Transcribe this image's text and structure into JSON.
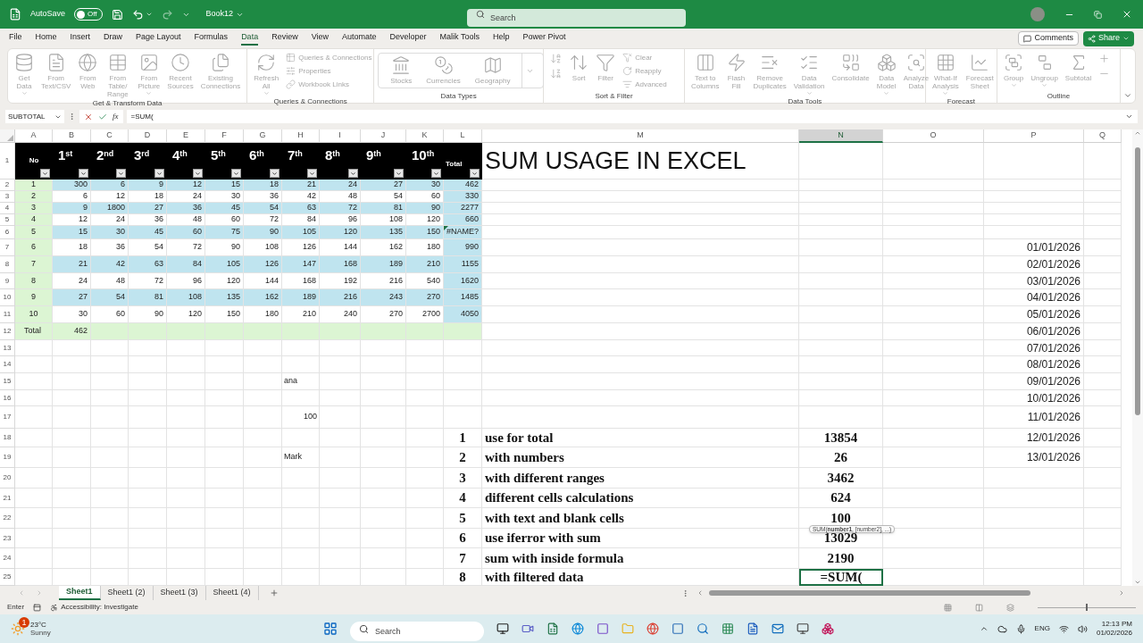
{
  "title_bar": {
    "autosave_label": "AutoSave",
    "autosave": {
      "on": false,
      "label": "Off"
    },
    "workbook": "Book12",
    "search": {
      "placeholder": "Search"
    }
  },
  "menu": {
    "tabs": [
      {
        "label": "File",
        "selected": false
      },
      {
        "label": "Home",
        "selected": false
      },
      {
        "label": "Insert",
        "selected": false
      },
      {
        "label": "Draw",
        "selected": false
      },
      {
        "label": "Page Layout",
        "selected": false
      },
      {
        "label": "Formulas",
        "selected": false
      },
      {
        "label": "Data",
        "selected": true
      },
      {
        "label": "Review",
        "selected": false
      },
      {
        "label": "View",
        "selected": false
      },
      {
        "label": "Automate",
        "selected": false
      },
      {
        "label": "Developer",
        "selected": false
      },
      {
        "label": "Malik Tools",
        "selected": false
      },
      {
        "label": "Help",
        "selected": false
      },
      {
        "label": "Power Pivot",
        "selected": false
      }
    ],
    "comments": "Comments",
    "share": "Share"
  },
  "ribbon": {
    "disabled": true,
    "groups": [
      {
        "label": "Get & Transform Data",
        "items": [
          {
            "kind": "large",
            "label": "Get\nData",
            "dropdown": true
          },
          {
            "kind": "large",
            "label": "From\nText/CSV",
            "dropdown": false
          },
          {
            "kind": "large",
            "label": "From\nWeb",
            "dropdown": false
          },
          {
            "kind": "large",
            "label": "From Table/\nRange",
            "dropdown": false
          },
          {
            "kind": "large",
            "label": "From\nPicture",
            "dropdown": true
          },
          {
            "kind": "large",
            "label": "Recent\nSources",
            "dropdown": false
          },
          {
            "kind": "large",
            "label": "Existing\nConnections",
            "dropdown": false
          }
        ]
      },
      {
        "label": "Queries & Connections",
        "items": [
          {
            "kind": "large",
            "label": "Refresh\nAll",
            "dropdown": true
          },
          {
            "kind": "small",
            "label": "Queries & Connections",
            "dropdown": false
          },
          {
            "kind": "small",
            "label": "Properties",
            "dropdown": false
          },
          {
            "kind": "small",
            "label": "Workbook Links",
            "dropdown": false
          }
        ]
      },
      {
        "label": "Data Types",
        "items": [
          {
            "kind": "gallery",
            "label": "Stocks",
            "dropdown": false
          },
          {
            "kind": "gallery",
            "label": "Currencies",
            "dropdown": false
          },
          {
            "kind": "gallery",
            "label": "Geography",
            "dropdown": false
          }
        ]
      },
      {
        "label": "Sort & Filter",
        "items": [
          {
            "kind": "icon",
            "dropdown": false
          },
          {
            "kind": "icon",
            "dropdown": false
          },
          {
            "kind": "large",
            "label": "Sort",
            "dropdown": false
          },
          {
            "kind": "large",
            "label": "Filter",
            "dropdown": false
          },
          {
            "kind": "small",
            "label": "Clear",
            "dropdown": false
          },
          {
            "kind": "small",
            "label": "Reapply",
            "dropdown": false
          },
          {
            "kind": "small",
            "label": "Advanced",
            "dropdown": false
          }
        ]
      },
      {
        "label": "Data Tools",
        "items": [
          {
            "kind": "large",
            "label": "Text to\nColumns",
            "dropdown": false
          },
          {
            "kind": "large",
            "label": "Flash\nFill",
            "dropdown": false
          },
          {
            "kind": "large",
            "label": "Remove\nDuplicates",
            "dropdown": false
          },
          {
            "kind": "large",
            "label": "Data\nValidation",
            "dropdown": true
          },
          {
            "kind": "large",
            "label": "Consolidate",
            "dropdown": false
          },
          {
            "kind": "large",
            "label": "Data\nModel",
            "dropdown": true
          },
          {
            "kind": "large",
            "label": "Analyze\nData",
            "dropdown": false
          }
        ]
      },
      {
        "label": "Forecast",
        "items": [
          {
            "kind": "large",
            "label": "What-If\nAnalysis",
            "dropdown": true
          },
          {
            "kind": "large",
            "label": "Forecast\nSheet",
            "dropdown": false
          }
        ]
      },
      {
        "label": "Outline",
        "items": [
          {
            "kind": "large",
            "label": "Group",
            "dropdown": true
          },
          {
            "kind": "large",
            "label": "Ungroup",
            "dropdown": true
          },
          {
            "kind": "large",
            "label": "Subtotal",
            "dropdown": false
          },
          {
            "kind": "icon",
            "dropdown": false
          },
          {
            "kind": "icon",
            "dropdown": false
          }
        ]
      }
    ]
  },
  "formula_bar": {
    "name_box": "SUBTOTAL",
    "function_label": "fx",
    "formula": "=SUM("
  },
  "sheet": {
    "columns": [
      {
        "label": "A",
        "selected": false
      },
      {
        "label": "B",
        "selected": false
      },
      {
        "label": "C",
        "selected": false
      },
      {
        "label": "D",
        "selected": false
      },
      {
        "label": "E",
        "selected": false
      },
      {
        "label": "F",
        "selected": false
      },
      {
        "label": "G",
        "selected": false
      },
      {
        "label": "H",
        "selected": false
      },
      {
        "label": "I",
        "selected": false
      },
      {
        "label": "J",
        "selected": false
      },
      {
        "label": "K",
        "selected": false
      },
      {
        "label": "L",
        "selected": false
      },
      {
        "label": "M",
        "selected": false
      },
      {
        "label": "N",
        "selected": true
      },
      {
        "label": "O",
        "selected": false
      },
      {
        "label": "P",
        "selected": false
      },
      {
        "label": "Q",
        "selected": false
      }
    ],
    "row_numbers": [
      "1",
      "2",
      "3",
      "4",
      "5",
      "6",
      "7",
      "8",
      "9",
      "10",
      "11",
      "12",
      "13",
      "14",
      "15",
      "16",
      "17",
      "18",
      "19",
      "20",
      "21",
      "22",
      "23",
      "24",
      "25"
    ],
    "data_table": {
      "headers": [
        {
          "kind": "label",
          "text": "No"
        },
        {
          "kind": "ordinal",
          "text": "1$^{st}$"
        },
        {
          "kind": "ordinal",
          "text": "2$^{nd}$"
        },
        {
          "kind": "ordinal",
          "text": "3$^{rd}$"
        },
        {
          "kind": "ordinal",
          "text": "4$^{th}$"
        },
        {
          "kind": "ordinal",
          "text": "5$^{th}$"
        },
        {
          "kind": "ordinal",
          "text": "6$^{th}$"
        },
        {
          "kind": "ordinal",
          "text": "7$^{th}$"
        },
        {
          "kind": "ordinal",
          "text": "8$^{th}$"
        },
        {
          "kind": "ordinal",
          "text": "9$^{th}$"
        },
        {
          "kind": "ordinal",
          "text": "10$^{th}$"
        },
        {
          "kind": "label",
          "text": "Total"
        }
      ],
      "rows": [
        {
          "values": [
            "1",
            "300",
            "6",
            "9",
            "12",
            "15",
            "18",
            "21",
            "24",
            "27",
            "30"
          ],
          "total": "462",
          "flagged": false
        },
        {
          "values": [
            "2",
            "6",
            "12",
            "18",
            "24",
            "30",
            "36",
            "42",
            "48",
            "54",
            "60"
          ],
          "total": "330",
          "flagged": false
        },
        {
          "values": [
            "3",
            "9",
            "1800",
            "27",
            "36",
            "45",
            "54",
            "63",
            "72",
            "81",
            "90"
          ],
          "total": "2277",
          "flagged": false
        },
        {
          "values": [
            "4",
            "12",
            "24",
            "36",
            "48",
            "60",
            "72",
            "84",
            "96",
            "108",
            "120"
          ],
          "total": "660",
          "flagged": false
        },
        {
          "values": [
            "5",
            "15",
            "30",
            "45",
            "60",
            "75",
            "90",
            "105",
            "120",
            "135",
            "150"
          ],
          "total": "#NAME?",
          "flagged": true
        },
        {
          "values": [
            "6",
            "18",
            "36",
            "54",
            "72",
            "90",
            "108",
            "126",
            "144",
            "162",
            "180"
          ],
          "total": "990",
          "flagged": false
        },
        {
          "values": [
            "7",
            "21",
            "42",
            "63",
            "84",
            "105",
            "126",
            "147",
            "168",
            "189",
            "210"
          ],
          "total": "1155",
          "flagged": false
        },
        {
          "values": [
            "8",
            "24",
            "48",
            "72",
            "96",
            "120",
            "144",
            "168",
            "192",
            "216",
            "540"
          ],
          "total": "1620",
          "flagged": false
        },
        {
          "values": [
            "9",
            "27",
            "54",
            "81",
            "108",
            "135",
            "162",
            "189",
            "216",
            "243",
            "270"
          ],
          "total": "1485",
          "flagged": false
        },
        {
          "values": [
            "10",
            "30",
            "60",
            "90",
            "120",
            "150",
            "180",
            "210",
            "240",
            "270",
            "2700"
          ],
          "total": "4050",
          "flagged": false
        }
      ],
      "total_row": [
        "Total",
        "462"
      ]
    },
    "title": "SUM USAGE IN EXCEL",
    "notes": [
      {
        "kind": "text",
        "text": "ana"
      },
      {
        "kind": "number",
        "text": "100"
      },
      {
        "kind": "text",
        "text": "Mark"
      }
    ],
    "dates": [
      "01/01/2026",
      "02/01/2026",
      "03/01/2026",
      "04/01/2026",
      "05/01/2026",
      "06/01/2026",
      "07/01/2026",
      "08/01/2026",
      "09/01/2026",
      "10/01/2026",
      "11/01/2026",
      "12/01/2026",
      "13/01/2026"
    ],
    "sum_usage": [
      {
        "number": "1",
        "label": "use for total",
        "result": "13854",
        "active": false
      },
      {
        "number": "2",
        "label": "with numbers",
        "result": "26",
        "active": false
      },
      {
        "number": "3",
        "label": "with different ranges",
        "result": "3462",
        "active": false
      },
      {
        "number": "4",
        "label": "different cells calculations",
        "result": "624",
        "active": false
      },
      {
        "number": "5",
        "label": "with text and blank cells",
        "result": "100",
        "active": false
      },
      {
        "number": "6",
        "label": "use iferror with sum",
        "result": "13029",
        "active": false
      },
      {
        "number": "7",
        "label": "sum with inside formula",
        "result": "2190",
        "active": false
      },
      {
        "number": "8",
        "label": "with filtered data",
        "result": "=SUM(",
        "active": true
      }
    ],
    "tooltip": "SUM(**number1**, [number2], ...)"
  },
  "sheet_tabs": [
    {
      "label": "Sheet1",
      "selected": true
    },
    {
      "label": "Sheet1 (2)",
      "selected": false
    },
    {
      "label": "Sheet1 (3)",
      "selected": false
    },
    {
      "label": "Sheet1 (4)",
      "selected": false
    }
  ],
  "status_bar": {
    "mode": "Enter",
    "accessibility": "Accessibility: Investigate",
    "zoom": {
      "level": 0.5
    }
  },
  "taskbar": {
    "weather": {
      "temperature": "23°C",
      "condition": "Sunny",
      "badge": "1"
    },
    "search": {
      "placeholder": "Search"
    },
    "language": "ENG",
    "time": "12:13 PM",
    "date": "01/02/2026"
  }
}
